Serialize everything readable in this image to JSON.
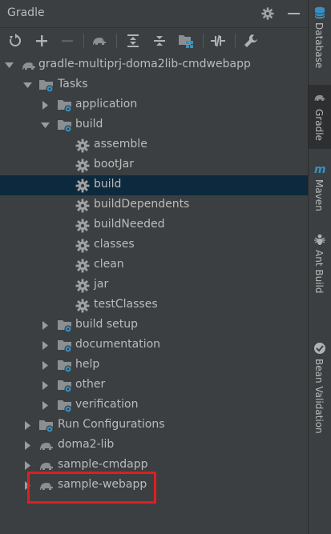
{
  "panel": {
    "title": "Gradle"
  },
  "toolbar": {
    "buttons": [
      {
        "name": "refresh-icon"
      },
      {
        "name": "add-icon"
      },
      {
        "name": "remove-icon"
      },
      {
        "name": "elephant-icon"
      },
      {
        "name": "expand-all-icon"
      },
      {
        "name": "collapse-all-icon"
      },
      {
        "name": "group-modules-icon"
      },
      {
        "name": "toggle-offline-icon"
      },
      {
        "name": "wrench-icon"
      }
    ]
  },
  "tree": {
    "root": "gradle-multiprj-doma2lib-cmdwebapp",
    "tasks": "Tasks",
    "application": "application",
    "build": "build",
    "build_tasks": [
      "assemble",
      "bootJar",
      "build",
      "buildDependents",
      "buildNeeded",
      "classes",
      "clean",
      "jar",
      "testClasses"
    ],
    "build_setup": "build setup",
    "documentation": "documentation",
    "help": "help",
    "other": "other",
    "verification": "verification",
    "run_configurations": "Run Configurations",
    "doma2_lib": "doma2-lib",
    "sample_cmdapp": "sample-cmdapp",
    "sample_webapp": "sample-webapp",
    "selected": "build"
  },
  "sidebar": {
    "tabs": [
      {
        "label": "Database",
        "icon": "database-icon"
      },
      {
        "label": "Gradle",
        "icon": "gradle-icon",
        "active": true
      },
      {
        "label": "Maven",
        "icon": "maven-icon"
      },
      {
        "label": "Ant Build",
        "icon": "ant-icon"
      },
      {
        "label": "Bean Validation",
        "icon": "bean-validation-icon"
      }
    ]
  },
  "colors": {
    "background": "#3c3f41",
    "selection": "#0d293e",
    "text": "#bbbbbb",
    "highlight": "#e01e1e"
  }
}
